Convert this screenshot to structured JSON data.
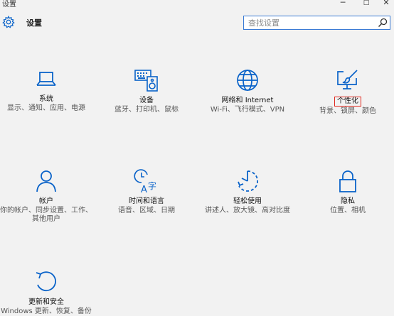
{
  "window": {
    "title": "设置",
    "controls": {
      "minimize": "─",
      "maximize": "□",
      "close": "✕"
    }
  },
  "header": {
    "title": "设置",
    "icon": "gear-icon"
  },
  "search": {
    "placeholder": "查找设置",
    "icon": "search-icon"
  },
  "accent_color": "#0a63c9",
  "highlight_color": "#e0281e",
  "categories": [
    {
      "id": "system",
      "name": "系统",
      "description": "显示、通知、应用、电源",
      "icon": "laptop-icon"
    },
    {
      "id": "devices",
      "name": "设备",
      "description": "蓝牙、打印机、鼠标",
      "icon": "keyboard-speaker-icon"
    },
    {
      "id": "network",
      "name": "网络和 Internet",
      "description": "Wi-Fi、飞行模式、VPN",
      "icon": "globe-icon"
    },
    {
      "id": "personalization",
      "name": "个性化",
      "description": "背景、锁屏、颜色",
      "icon": "paint-monitor-icon",
      "highlighted": true
    },
    {
      "id": "accounts",
      "name": "帐户",
      "description": "你的帐户、同步设置、工作、其他用户",
      "icon": "person-icon"
    },
    {
      "id": "time-language",
      "name": "时间和语言",
      "description": "语音、区域、日期",
      "icon": "time-language-icon"
    },
    {
      "id": "ease-of-access",
      "name": "轻松使用",
      "description": "讲述人、放大镜、高对比度",
      "icon": "ease-of-access-icon"
    },
    {
      "id": "privacy",
      "name": "隐私",
      "description": "位置、相机",
      "icon": "lock-icon"
    },
    {
      "id": "update-security",
      "name": "更新和安全",
      "description": "Windows 更新、恢复、备份",
      "icon": "refresh-icon"
    }
  ]
}
